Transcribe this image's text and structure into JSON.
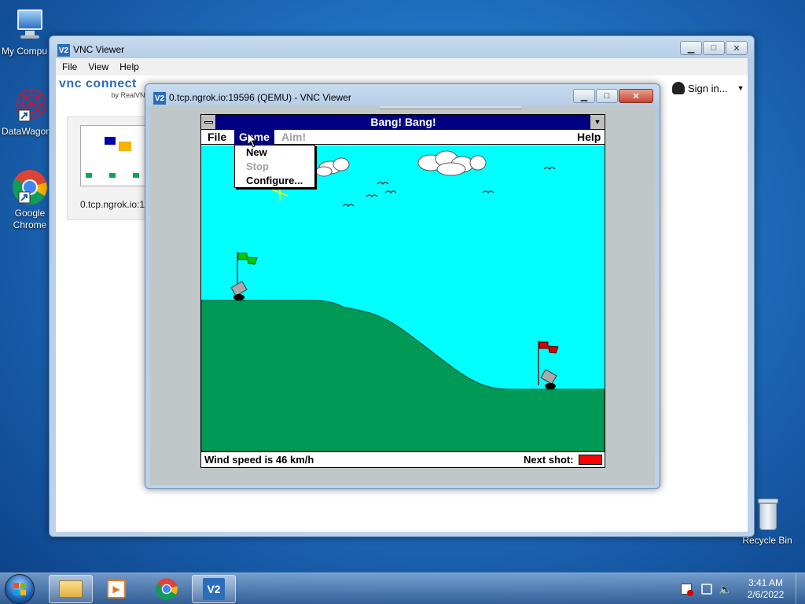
{
  "desktop": {
    "icons": [
      {
        "label": "My Compu"
      },
      {
        "label": "DataWagor"
      },
      {
        "label": "Google\nChrome"
      },
      {
        "label": "Recycle Bin"
      }
    ]
  },
  "vnc_viewer": {
    "title": "VNC Viewer",
    "menu": [
      "File",
      "View",
      "Help"
    ],
    "logo_main": "vnc connect",
    "logo_sub": "by RealVNC",
    "sign_in": "Sign in...",
    "thumbnail_label": "0.tcp.ngrok.io:1"
  },
  "session_window": {
    "title": "0.tcp.ngrok.io:19596 (QEMU) - VNC Viewer"
  },
  "game": {
    "title": "Bang! Bang!",
    "menu": {
      "file": "File",
      "game": "Game",
      "aim": "Aim!",
      "help": "Help"
    },
    "game_menu_items": [
      {
        "label": "New",
        "enabled": true
      },
      {
        "label": "Stop",
        "enabled": false
      },
      {
        "label": "Configure...",
        "enabled": true
      }
    ],
    "status_wind": "Wind speed is 46 km/h",
    "status_next_shot": "Next shot:",
    "next_shot_color": "#ff0000",
    "colors": {
      "sky": "#00ffff",
      "ground": "#009955",
      "title_bar": "#000080"
    }
  },
  "taskbar": {
    "time": "3:41 AM",
    "date": "2/6/2022"
  }
}
